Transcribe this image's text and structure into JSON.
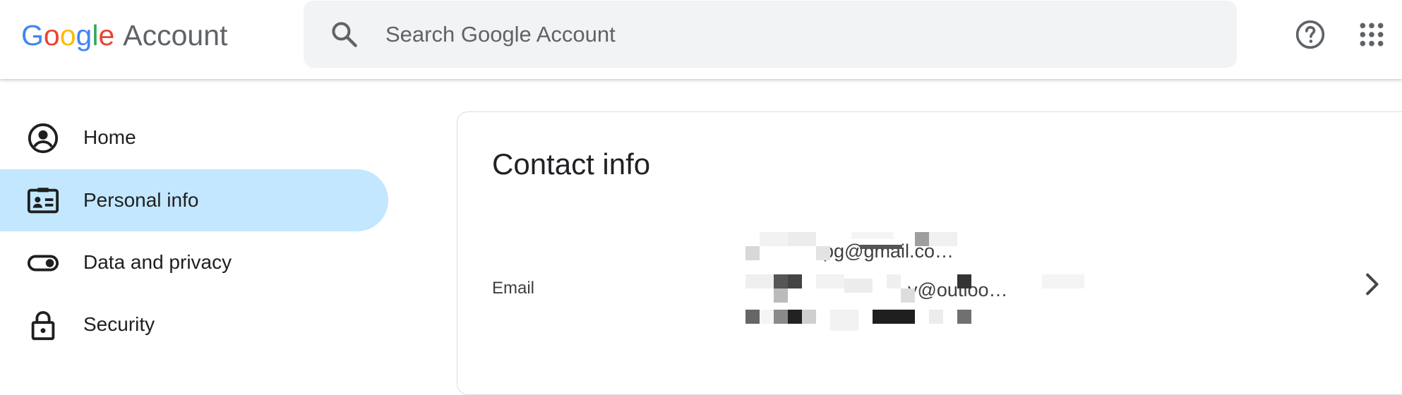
{
  "header": {
    "logo": {
      "letters": [
        "G",
        "o",
        "o",
        "g",
        "l",
        "e"
      ],
      "product": "Account"
    },
    "search": {
      "placeholder": "Search Google Account",
      "value": "",
      "icon": "search-icon"
    },
    "help_icon": "help-circle-icon",
    "apps_icon": "apps-grid-icon"
  },
  "sidebar": {
    "items": [
      {
        "label": "Home",
        "icon": "account-circle-icon",
        "active": false
      },
      {
        "label": "Personal info",
        "icon": "id-card-icon",
        "active": true
      },
      {
        "label": "Data and privacy",
        "icon": "toggle-icon",
        "active": false
      },
      {
        "label": "Security",
        "icon": "lock-icon",
        "active": false
      }
    ]
  },
  "main": {
    "section_title": "Contact info",
    "email": {
      "label": "Email",
      "values": [
        "pg@gmail.co…",
        "y@outloo…",
        ""
      ]
    }
  },
  "colors": {
    "google_blue": "#4285F4",
    "google_red": "#EA4335",
    "google_yellow": "#FBBC05",
    "google_green": "#34A853",
    "active_nav_bg": "#c2e7ff",
    "search_bg": "#f1f3f4"
  }
}
